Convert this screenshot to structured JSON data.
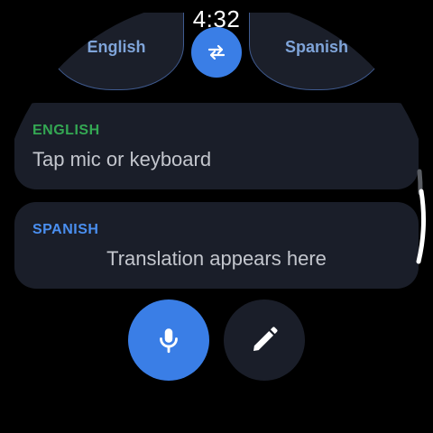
{
  "status": {
    "time": "4:32"
  },
  "languages": {
    "source": "English",
    "target": "Spanish",
    "swap_icon": "swap-arrows-icon"
  },
  "source_card": {
    "label": "ENGLISH",
    "text": "Tap mic or keyboard"
  },
  "target_card": {
    "label": "SPANISH",
    "text": "Translation appears here"
  },
  "actions": {
    "mic_icon": "microphone-icon",
    "edit_icon": "pencil-icon"
  },
  "colors": {
    "accent": "#3a7ee6",
    "source_label": "#34a853",
    "target_label": "#4a8ff0",
    "card_bg": "#1a1e29"
  }
}
